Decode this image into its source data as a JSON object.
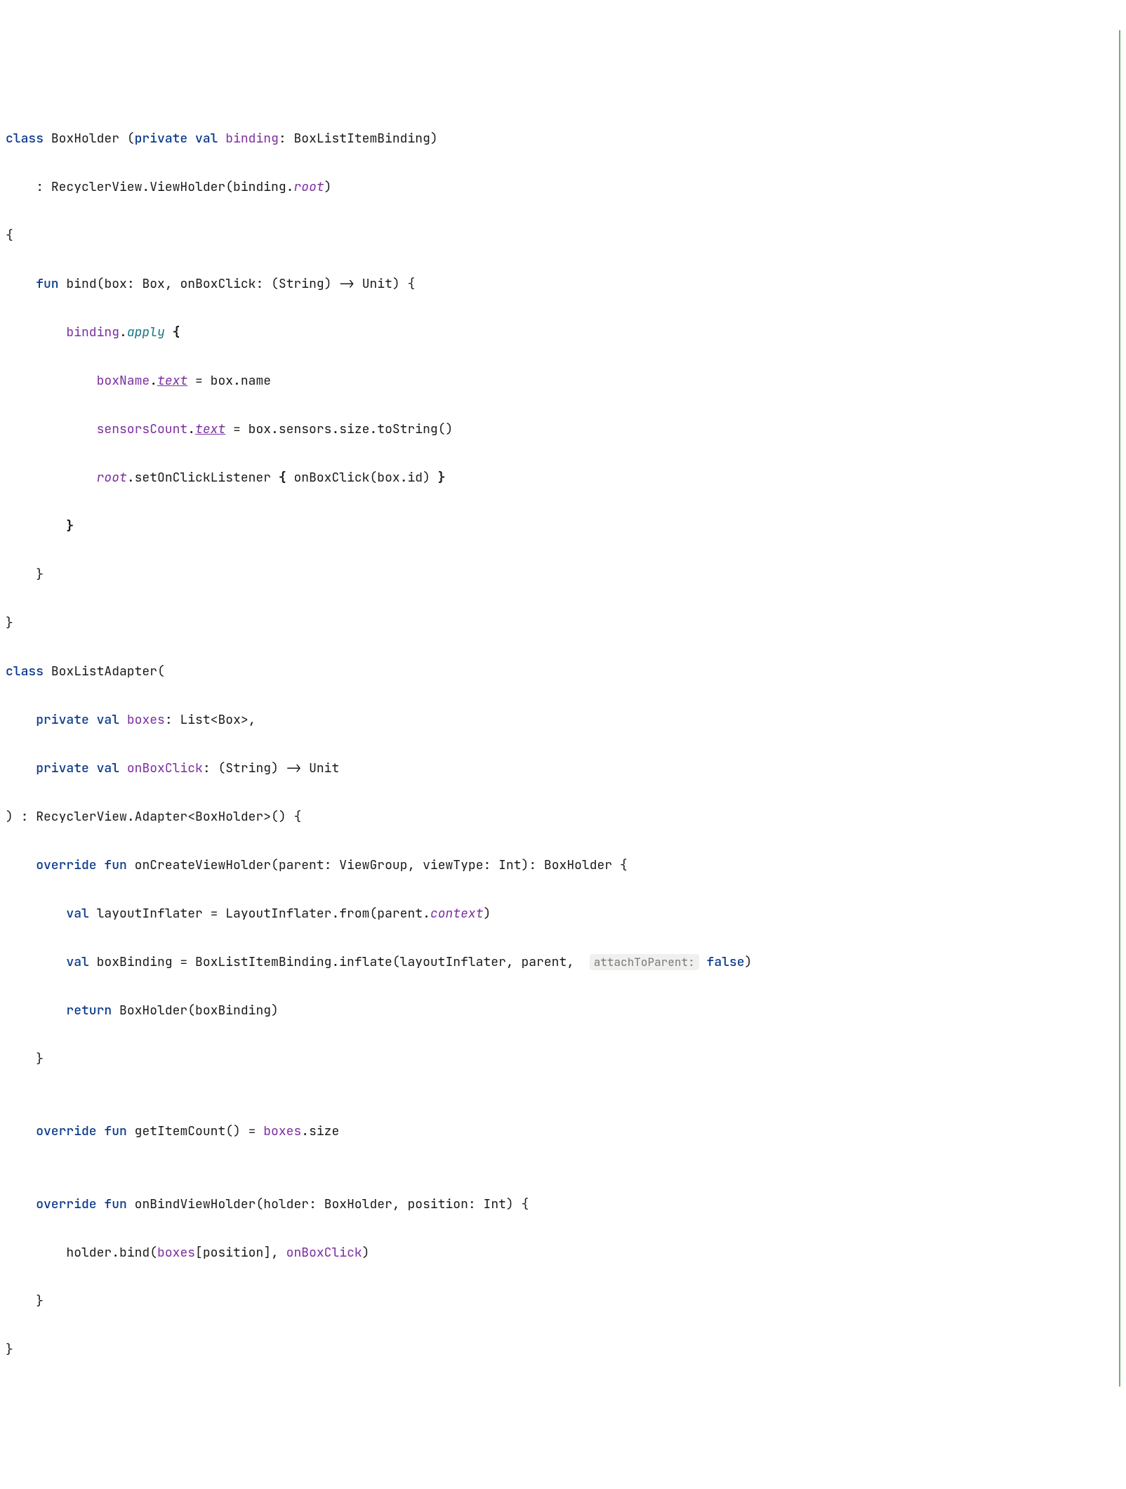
{
  "code": {
    "tokens": {
      "class": "class",
      "fun": "fun",
      "private": "private",
      "val": "val",
      "override": "override",
      "return": "return",
      "false": "false"
    },
    "identifiers": {
      "BoxHolder": "BoxHolder",
      "binding": "binding",
      "BoxListItemBinding": "BoxListItemBinding",
      "RecyclerView": "RecyclerView",
      "ViewHolder": "ViewHolder",
      "root": "root",
      "bind": "bind",
      "box": "box",
      "Box": "Box",
      "onBoxClick": "onBoxClick",
      "String": "String",
      "Unit": "Unit",
      "apply": "apply",
      "boxName": "boxName",
      "text": "text",
      "name": "name",
      "sensorsCount": "sensorsCount",
      "sensors": "sensors",
      "size": "size",
      "toString": "toString",
      "setOnClickListener": "setOnClickListener",
      "id": "id",
      "BoxListAdapter": "BoxListAdapter",
      "boxes": "boxes",
      "List": "List",
      "Adapter": "Adapter",
      "onCreateViewHolder": "onCreateViewHolder",
      "parent": "parent",
      "ViewGroup": "ViewGroup",
      "viewType": "viewType",
      "Int": "Int",
      "layoutInflater": "layoutInflater",
      "LayoutInflater": "LayoutInflater",
      "from": "from",
      "context": "context",
      "boxBinding": "boxBinding",
      "inflate": "inflate",
      "attachToParent": "attachToParent:",
      "getItemCount": "getItemCount",
      "onBindViewHolder": "onBindViewHolder",
      "holder": "holder",
      "position": "position"
    }
  }
}
